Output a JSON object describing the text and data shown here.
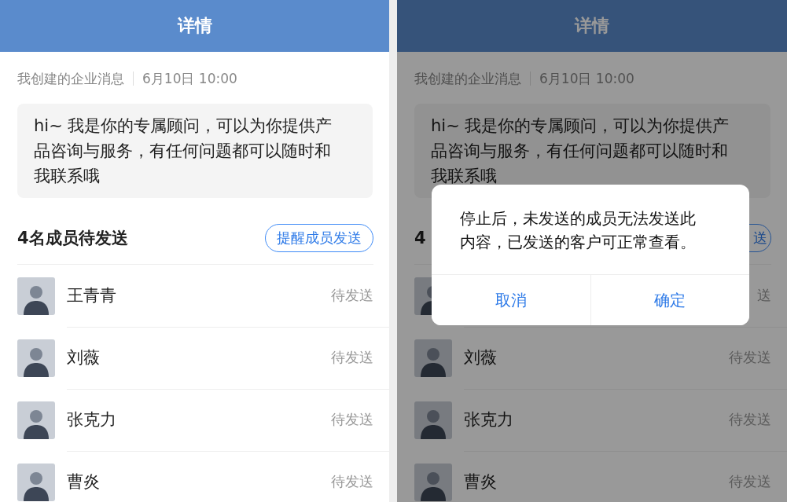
{
  "screens": [
    {
      "dimmed": false,
      "header": {
        "title": "详情"
      },
      "meta": {
        "source": "我创建的企业消息",
        "time": "6月10日 10:00"
      },
      "message": "hi~ 我是你的专属顾问，可以为你提供产品咨询与服务，有任何问题都可以随时和我联系哦",
      "pending": {
        "title": "4名成员待发送",
        "button": "提醒成员发送"
      },
      "members": [
        {
          "name": "王青青",
          "status": "待发送"
        },
        {
          "name": "刘薇",
          "status": "待发送"
        },
        {
          "name": "张克力",
          "status": "待发送"
        },
        {
          "name": "曹炎",
          "status": "待发送"
        }
      ]
    },
    {
      "dimmed": true,
      "header": {
        "title": "详情"
      },
      "meta": {
        "source": "我创建的企业消息",
        "time": "6月10日 10:00"
      },
      "message": "hi~ 我是你的专属顾问，可以为你提供产品咨询与服务，有任何问题都可以随时和我联系哦",
      "pending": {
        "title": "4",
        "button": "送"
      },
      "members": [
        {
          "status": "送"
        },
        {
          "name": "刘薇",
          "status": "待发送"
        },
        {
          "name": "张克力",
          "status": "待发送"
        },
        {
          "name": "曹炎",
          "status": "待发送"
        }
      ],
      "dialog": {
        "text": "停止后，未发送的成员无法发送此内容，已发送的客户可正常查看。",
        "buttons": [
          "取消",
          "确定"
        ]
      }
    }
  ]
}
